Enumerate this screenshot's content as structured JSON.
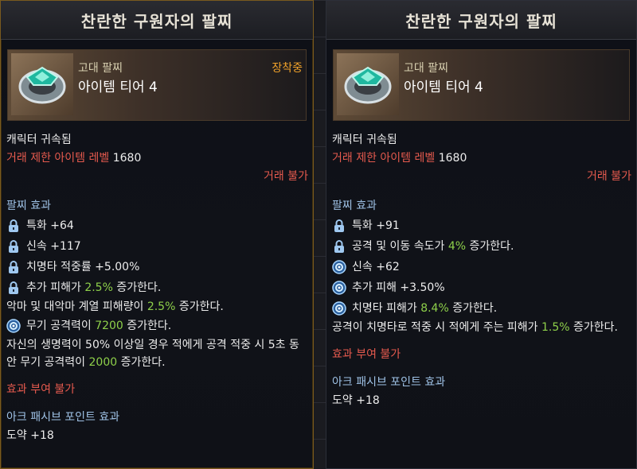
{
  "left": {
    "title": "찬란한 구원자의 팔찌",
    "grade": "고대 팔찌",
    "tier": "아이템 티어 4",
    "equipped": "장착중",
    "bound": "캐릭터 귀속됨",
    "trade_level_label": "거래 제한 아이템 레벨",
    "trade_level_value": "1680",
    "trade_status": "거래 불가",
    "effect_header": "팔찌 효과",
    "effects": [
      {
        "icon": "lock",
        "text": "특화 +64"
      },
      {
        "icon": "lock",
        "text": "신속 +117"
      },
      {
        "icon": "lock",
        "text": "치명타 적중률 +5.00%"
      },
      {
        "icon": "lock",
        "pre": "추가 피해가 ",
        "hl": "2.5%",
        "post": " 증가한다."
      },
      {
        "icon": "",
        "pre": "악마 및 대악마 계열 피해량이 ",
        "hl": "2.5%",
        "post": " 증가한다."
      },
      {
        "icon": "orb",
        "pre": "무기 공격력이 ",
        "hl": "7200",
        "post": " 증가한다."
      },
      {
        "icon": "",
        "pre": "자신의 생명력이 50% 이상일 경우 적에게 공격 적중 시 5초 동안 무기 공격력이 ",
        "hl": "2000",
        "post": " 증가한다."
      }
    ],
    "no_grant": "효과 부여 불가",
    "ark_header": "아크 패시브 포인트 효과",
    "ark_value": "도약 +18"
  },
  "right": {
    "title": "찬란한 구원자의 팔찌",
    "grade": "고대 팔찌",
    "tier": "아이템 티어 4",
    "bound": "캐릭터 귀속됨",
    "trade_level_label": "거래 제한 아이템 레벨",
    "trade_level_value": "1680",
    "trade_status": "거래 불가",
    "effect_header": "팔찌 효과",
    "effects": [
      {
        "icon": "lock",
        "text": "특화 +91"
      },
      {
        "icon": "lock",
        "pre": "공격 및 이동 속도가 ",
        "hl": "4%",
        "post": " 증가한다."
      },
      {
        "icon": "orb",
        "text": "신속 +62"
      },
      {
        "icon": "orb",
        "text": "추가 피해 +3.50%"
      },
      {
        "icon": "orb",
        "pre": "치명타 피해가 ",
        "hl": "8.4%",
        "post": " 증가한다."
      },
      {
        "icon": "",
        "pre": "공격이 치명타로 적중 시 적에게 주는 피해가 ",
        "hl": "1.5%",
        "post": " 증가한다."
      }
    ],
    "no_grant": "효과 부여 불가",
    "ark_header": "아크 패시브 포인트 효과",
    "ark_value": "도약 +18"
  },
  "colors": {
    "highlight": "#8ed04a",
    "restriction": "#e65a4e",
    "section": "#9fc2e6",
    "equipped": "#f0a22a"
  }
}
